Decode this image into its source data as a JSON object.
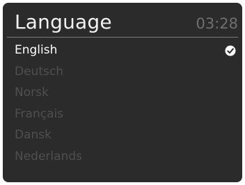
{
  "header": {
    "title": "Language",
    "time": "03:28"
  },
  "languages": [
    {
      "label": "English",
      "selected": true
    },
    {
      "label": "Deutsch",
      "selected": false
    },
    {
      "label": "Norsk",
      "selected": false
    },
    {
      "label": "Français",
      "selected": false
    },
    {
      "label": "Dansk",
      "selected": false
    },
    {
      "label": "Nederlands",
      "selected": false
    }
  ],
  "icons": {
    "selected_marker": "check-circle-icon"
  },
  "colors": {
    "background": "#2b2b2b",
    "selected_text": "#ffffff",
    "unselected_text": "#4f4f4f",
    "clock_text": "#6f6f6f"
  }
}
